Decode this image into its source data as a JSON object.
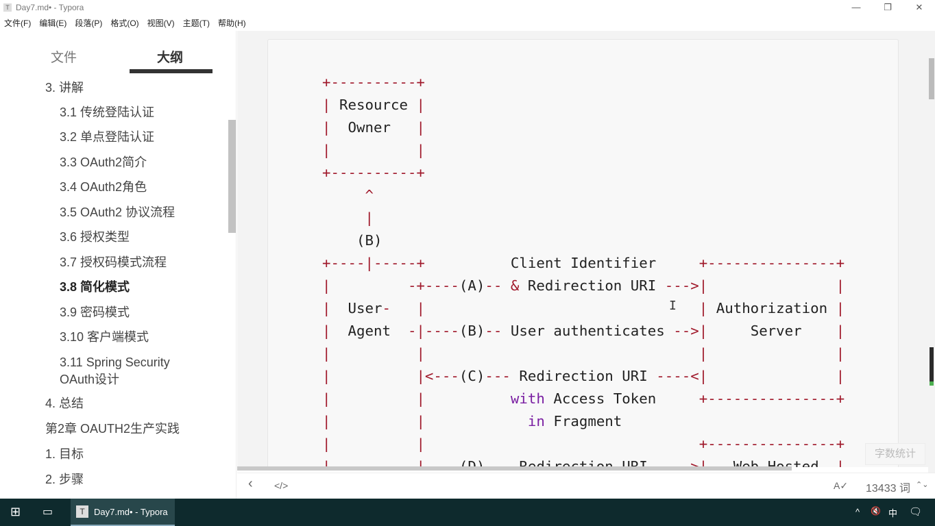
{
  "window": {
    "title": "Day7.md• - Typora",
    "app_icon": "T",
    "minimize": "—",
    "restore": "❐",
    "close": "✕"
  },
  "menu": [
    "文件(F)",
    "编辑(E)",
    "段落(P)",
    "格式(O)",
    "视图(V)",
    "主题(T)",
    "帮助(H)"
  ],
  "sidebar": {
    "tabs": {
      "files": "文件",
      "outline": "大纲"
    },
    "items": [
      {
        "label": "3. 讲解",
        "level": 1
      },
      {
        "label": "3.1 传统登陆认证",
        "level": 2
      },
      {
        "label": "3.2 单点登陆认证",
        "level": 2
      },
      {
        "label": "3.3 OAuth2简介",
        "level": 2
      },
      {
        "label": "3.4 OAuth2角色",
        "level": 2
      },
      {
        "label": "3.5 OAuth2 协议流程",
        "level": 2
      },
      {
        "label": "3.6 授权类型",
        "level": 2
      },
      {
        "label": "3.7 授权码模式流程",
        "level": 2
      },
      {
        "label": "3.8 简化模式",
        "level": 2,
        "active": true
      },
      {
        "label": "3.9 密码模式",
        "level": 2
      },
      {
        "label": "3.10 客户端模式",
        "level": 2
      },
      {
        "label": "3.11 Spring Security OAuth设计",
        "level": 2
      },
      {
        "label": "4. 总结",
        "level": 1
      },
      {
        "label": "第2章 OAUTH2生产实践",
        "level": 0
      },
      {
        "label": "1. 目标",
        "level": 1
      },
      {
        "label": "2. 步骤",
        "level": 1
      }
    ]
  },
  "code_lines": [
    "+----------+",
    "| Resource |",
    "|  Owner   |",
    "|          |",
    "+----------+",
    "     ^",
    "     |",
    "    (B)",
    "+----|-----+          Client Identifier     +---------------+",
    "|         -+----(A)-- & Redirection URI --->|               |",
    "|  User-   |                                | Authorization |",
    "|  Agent  -|----(B)-- User authenticates -->|     Server    |",
    "|          |                                |               |",
    "|          |<---(C)--- Redirection URI ----<|               |",
    "|          |          with Access Token     +---------------+",
    "|          |            in Fragment",
    "|          |                                +---------------+",
    "|          |----(D)--- Redirection URI ---->|   Web-Hosted  |"
  ],
  "colors": {
    "punct": "#a0192b",
    "keyword": "#7a1fa2",
    "taskbar": "#0e2a2d"
  },
  "word_count_button": "字数统计",
  "footer": {
    "back": "‹",
    "source": "</>",
    "spell_icon": "A✓",
    "word_count": "13433 词",
    "toggle": "⌃⌄"
  },
  "taskbar": {
    "start": "⊞",
    "task_view": "▭",
    "app_label": "Day7.md• - Typora",
    "tray_chevron": "^",
    "volume": "🔇",
    "ime": "中",
    "notifications": "🗨"
  }
}
